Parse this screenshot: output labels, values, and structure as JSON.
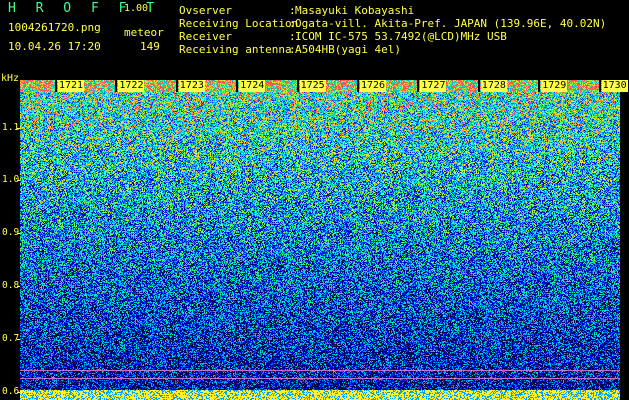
{
  "app": {
    "title": "H R O F F T",
    "version": "1.00"
  },
  "file": {
    "name": "1004261720.png",
    "datetime": "10.04.26 17:20"
  },
  "meteor": {
    "label": "meteor",
    "count": "149"
  },
  "info": [
    {
      "key": "Ovserver",
      "sep": ":",
      "value": "Masayuki Kobayashi"
    },
    {
      "key": "Receiving Location",
      "sep": ":",
      "value": "Ogata-vill. Akita-Pref. JAPAN (139.96E, 40.02N)"
    },
    {
      "key": "Receiver",
      "sep": ":",
      "value": "ICOM IC-575 53.7492(@LCD)MHz USB"
    },
    {
      "key": "Receiving antenna",
      "sep": ":",
      "value": "A504HB(yagi 4el)"
    }
  ],
  "y_axis": {
    "unit": "kHz",
    "ticks": [
      "1.1",
      "1.0",
      "0.9",
      "0.8",
      "0.7",
      "0.6"
    ],
    "tick_values": [
      1.1,
      1.0,
      0.9,
      0.8,
      0.7,
      0.6
    ],
    "range": [
      0.585,
      1.19
    ]
  },
  "time_axis": {
    "labels": [
      "1721",
      "1722",
      "1723",
      "1724",
      "1725",
      "1726",
      "1727",
      "1728",
      "1729",
      "1730"
    ]
  },
  "colors": {
    "text": "#ffff4a",
    "title": "#3cff8a",
    "marker_line": "#ff8bd8",
    "background": "#000000"
  }
}
